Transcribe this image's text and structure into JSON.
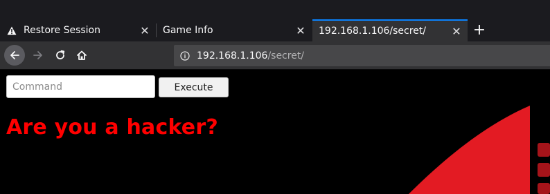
{
  "tabs": [
    {
      "label": "Restore Session",
      "icon": "warning-icon",
      "active": false
    },
    {
      "label": "Game Info",
      "icon": "",
      "active": false
    },
    {
      "label": "192.168.1.106/secret/",
      "icon": "",
      "active": true
    }
  ],
  "new_tab_glyph": "+",
  "close_glyph": "✕",
  "navbar": {
    "url_host": "192.168.1.106",
    "url_path": "/secret/"
  },
  "page": {
    "command_placeholder": "Command",
    "command_value": "",
    "execute_label": "Execute",
    "headline": "Are you a hacker?"
  },
  "colors": {
    "tabbar_bg": "#1b1b1f",
    "active_tab_bg": "#323234",
    "active_tab_accent": "#0a84ff",
    "toolbar_bg": "#323234",
    "urlbar_bg": "#474749",
    "page_bg": "#000000",
    "headline": "#ff0000",
    "decor_red": "#e31b23",
    "decor_dark_red": "#a5141a"
  }
}
